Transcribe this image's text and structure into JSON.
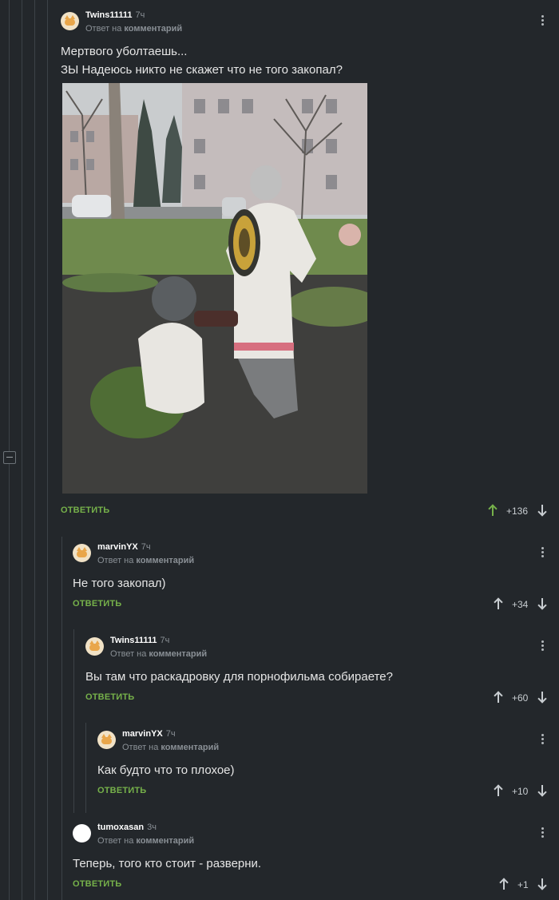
{
  "comments": [
    {
      "username": "Twins11111",
      "time": "7ч",
      "meta_prefix": "Ответ на",
      "meta_link": "комментарий",
      "text_lines": [
        "Мертвого уболтаешь...",
        "ЗЫ Надеюсь никто не скажет что не того закопал?"
      ],
      "reply_label": "ОТВЕТИТЬ",
      "rating": "+136",
      "upvoted": true,
      "image_alt": "Фото: скульптуры в парке"
    },
    {
      "username": "marvinYX",
      "time": "7ч",
      "meta_prefix": "Ответ на",
      "meta_link": "комментарий",
      "text": "Не того закопал)",
      "reply_label": "ОТВЕТИТЬ",
      "rating": "+34"
    },
    {
      "username": "Twins11111",
      "time": "7ч",
      "meta_prefix": "Ответ на",
      "meta_link": "комментарий",
      "text": "Вы там что раскадровку для порнофильма собираете?",
      "reply_label": "ОТВЕТИТЬ",
      "rating": "+60"
    },
    {
      "username": "marvinYX",
      "time": "7ч",
      "meta_prefix": "Ответ на",
      "meta_link": "комментарий",
      "text": "Как будто что то плохое)",
      "reply_label": "ОТВЕТИТЬ",
      "rating": "+10"
    },
    {
      "username": "tumoxasan",
      "time": "3ч",
      "meta_prefix": "Ответ на",
      "meta_link": "комментарий",
      "text": "Теперь, того кто стоит - разверни.",
      "reply_label": "ОТВЕТИТЬ",
      "rating": "+1"
    }
  ],
  "colors": {
    "background": "#23272b",
    "accent_green": "#76b14a",
    "thread_line": "#3c4247"
  },
  "icons": [
    "avatar-cat-icon",
    "more-options-icon",
    "upvote-arrow-icon",
    "downvote-arrow-icon",
    "collapse-thread-icon"
  ]
}
